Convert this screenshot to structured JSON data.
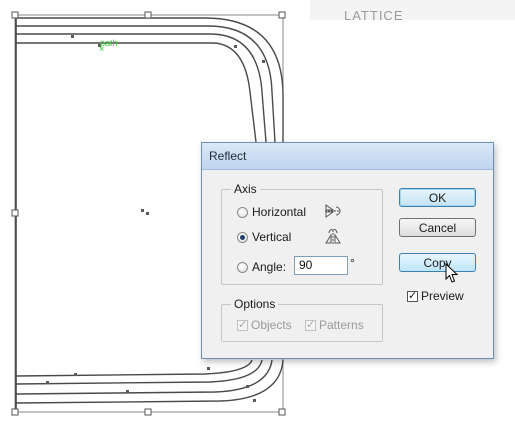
{
  "canvas": {
    "top_right_text": "LATTICE",
    "path_label": "path"
  },
  "dialog": {
    "title": "Reflect",
    "axis_group": {
      "title": "Axis",
      "options": [
        {
          "label": "Horizontal",
          "checked": false,
          "icon": "reflect-horizontal-icon"
        },
        {
          "label": "Vertical",
          "checked": true,
          "icon": "reflect-vertical-icon"
        }
      ],
      "angle_label": "Angle:",
      "angle_value": "90",
      "degree_symbol": "°"
    },
    "options_group": {
      "title": "Options",
      "objects_label": "Objects",
      "patterns_label": "Patterns"
    },
    "buttons": {
      "ok": "OK",
      "cancel": "Cancel",
      "copy": "Copy"
    },
    "preview_label": "Preview"
  },
  "colors": {
    "accent": "#3c7fb1",
    "path_label": "#3acb3a"
  }
}
